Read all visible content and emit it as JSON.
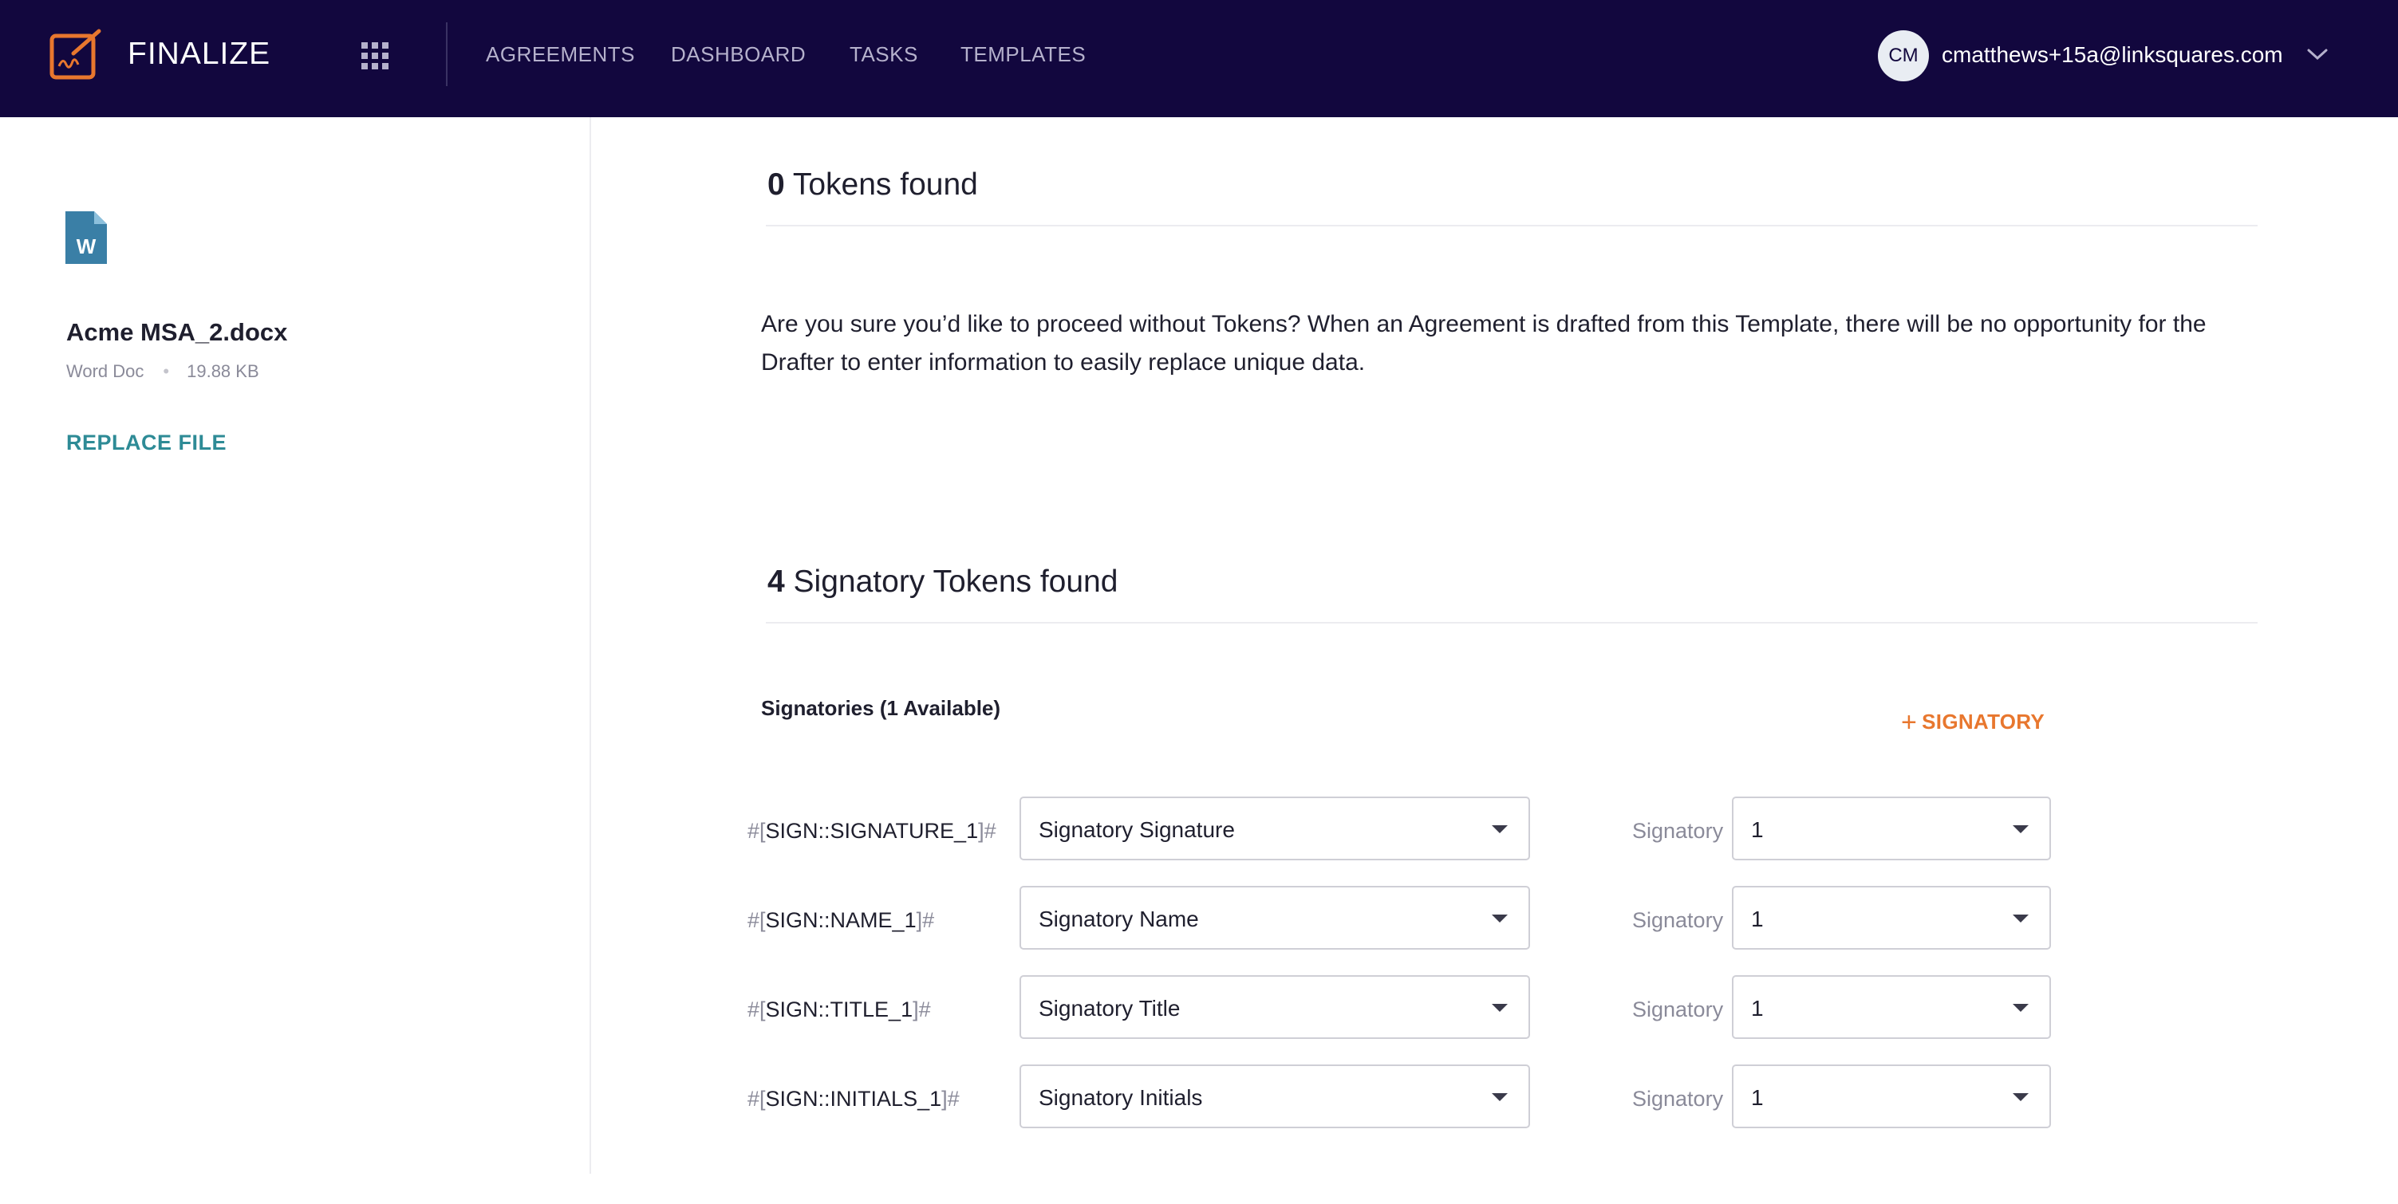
{
  "header": {
    "brand": "FINALIZE",
    "nav": [
      "AGREEMENTS",
      "DASHBOARD",
      "TASKS",
      "TEMPLATES"
    ],
    "user": {
      "initials": "CM",
      "email": "cmatthews+15a@linksquares.com"
    },
    "colors": {
      "background": "#12073e",
      "logo": "#e8772e"
    }
  },
  "sidebar": {
    "file_name": "Acme MSA_2.docx",
    "file_type": "Word Doc",
    "file_size": "19.88 KB",
    "replace_label": "REPLACE FILE"
  },
  "tokens_section": {
    "count": "0",
    "title": "Tokens found",
    "message": "Are you sure you’d like to proceed without Tokens? When an Agreement is drafted from this Template, there will be no opportunity for the Drafter to enter information to easily replace unique data."
  },
  "signatory_section": {
    "count": "4",
    "title": "Signatory Tokens found",
    "signatories_label": "Signatories (1 Available)",
    "add_label": "SIGNATORY",
    "token_prefix": "#[",
    "token_suffix": "]#",
    "signatory_label": "Signatory",
    "rows": [
      {
        "token": "SIGN::SIGNATURE_1",
        "type": "Signatory Signature",
        "signatory": "1"
      },
      {
        "token": "SIGN::NAME_1",
        "type": "Signatory Name",
        "signatory": "1"
      },
      {
        "token": "SIGN::TITLE_1",
        "type": "Signatory Title",
        "signatory": "1"
      },
      {
        "token": "SIGN::INITIALS_1",
        "type": "Signatory Initials",
        "signatory": "1"
      }
    ]
  }
}
